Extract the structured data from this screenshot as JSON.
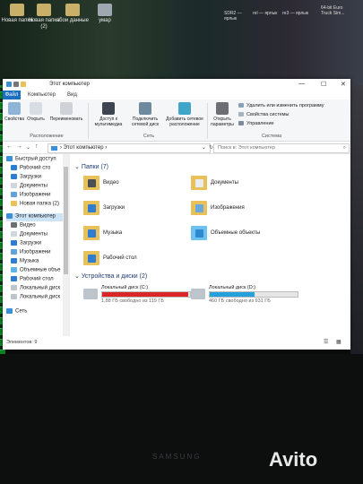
{
  "desktop": {
    "icons": [
      "Новая папка",
      "Новая папка (2)",
      "сбои данные",
      "умар"
    ],
    "top_right_items": [
      "SDR2 — ярлык",
      "rel — ярлык",
      "re3 — ярлык",
      "64-bit Euro Truck Sim..."
    ]
  },
  "window": {
    "title": "Этот компьютер",
    "menu": {
      "file": "Файл",
      "tabs": [
        "Компьютер",
        "Вид"
      ]
    },
    "ribbon": {
      "buttons": [
        "Свойства",
        "Открыть",
        "Переименовать",
        "Доступ к мультимедиа",
        "Подключить сетевой диск",
        "Добавить сетевое расположение",
        "Открыть параметры"
      ],
      "system_items": [
        "Удалить или изменить программу",
        "Свойства системы",
        "Управление"
      ],
      "groups": [
        "Расположение",
        "Сеть",
        "Система"
      ]
    },
    "address": {
      "path": "Этот компьютер",
      "search_placeholder": "Поиск в: Этот компьютер"
    },
    "nav": {
      "items": [
        "Быстрый доступ",
        "Рабочий сто",
        "Загрузки",
        "Документы",
        "Изображени",
        "Новая папка (2)",
        "Этот компьютер",
        "Видео",
        "Документы",
        "Загрузки",
        "Изображени",
        "Музыка",
        "Объемные объе",
        "Рабочий стол",
        "Локальный диск",
        "Локальный диск",
        "Сеть"
      ]
    },
    "content": {
      "folders_header": "Папки (7)",
      "folders": [
        "Видео",
        "Документы",
        "Загрузки",
        "Изображения",
        "Музыка",
        "Объемные объекты",
        "Рабочий стол"
      ],
      "devices_header": "Устройства и диски (2)",
      "drives": [
        {
          "name": "Локальный диск (C:)",
          "free": "1,88 ГБ свободно из 119 ГБ",
          "used": 0.98,
          "color": "#da2626"
        },
        {
          "name": "Локальный диск (D:)",
          "free": "460 ГБ свободно из 931 ГБ",
          "used": 0.51,
          "color": "#26a0da"
        }
      ]
    },
    "status": "Элементов: 9"
  },
  "monitor": {
    "brand": "SAMSUNG"
  },
  "watermark": "Avito"
}
